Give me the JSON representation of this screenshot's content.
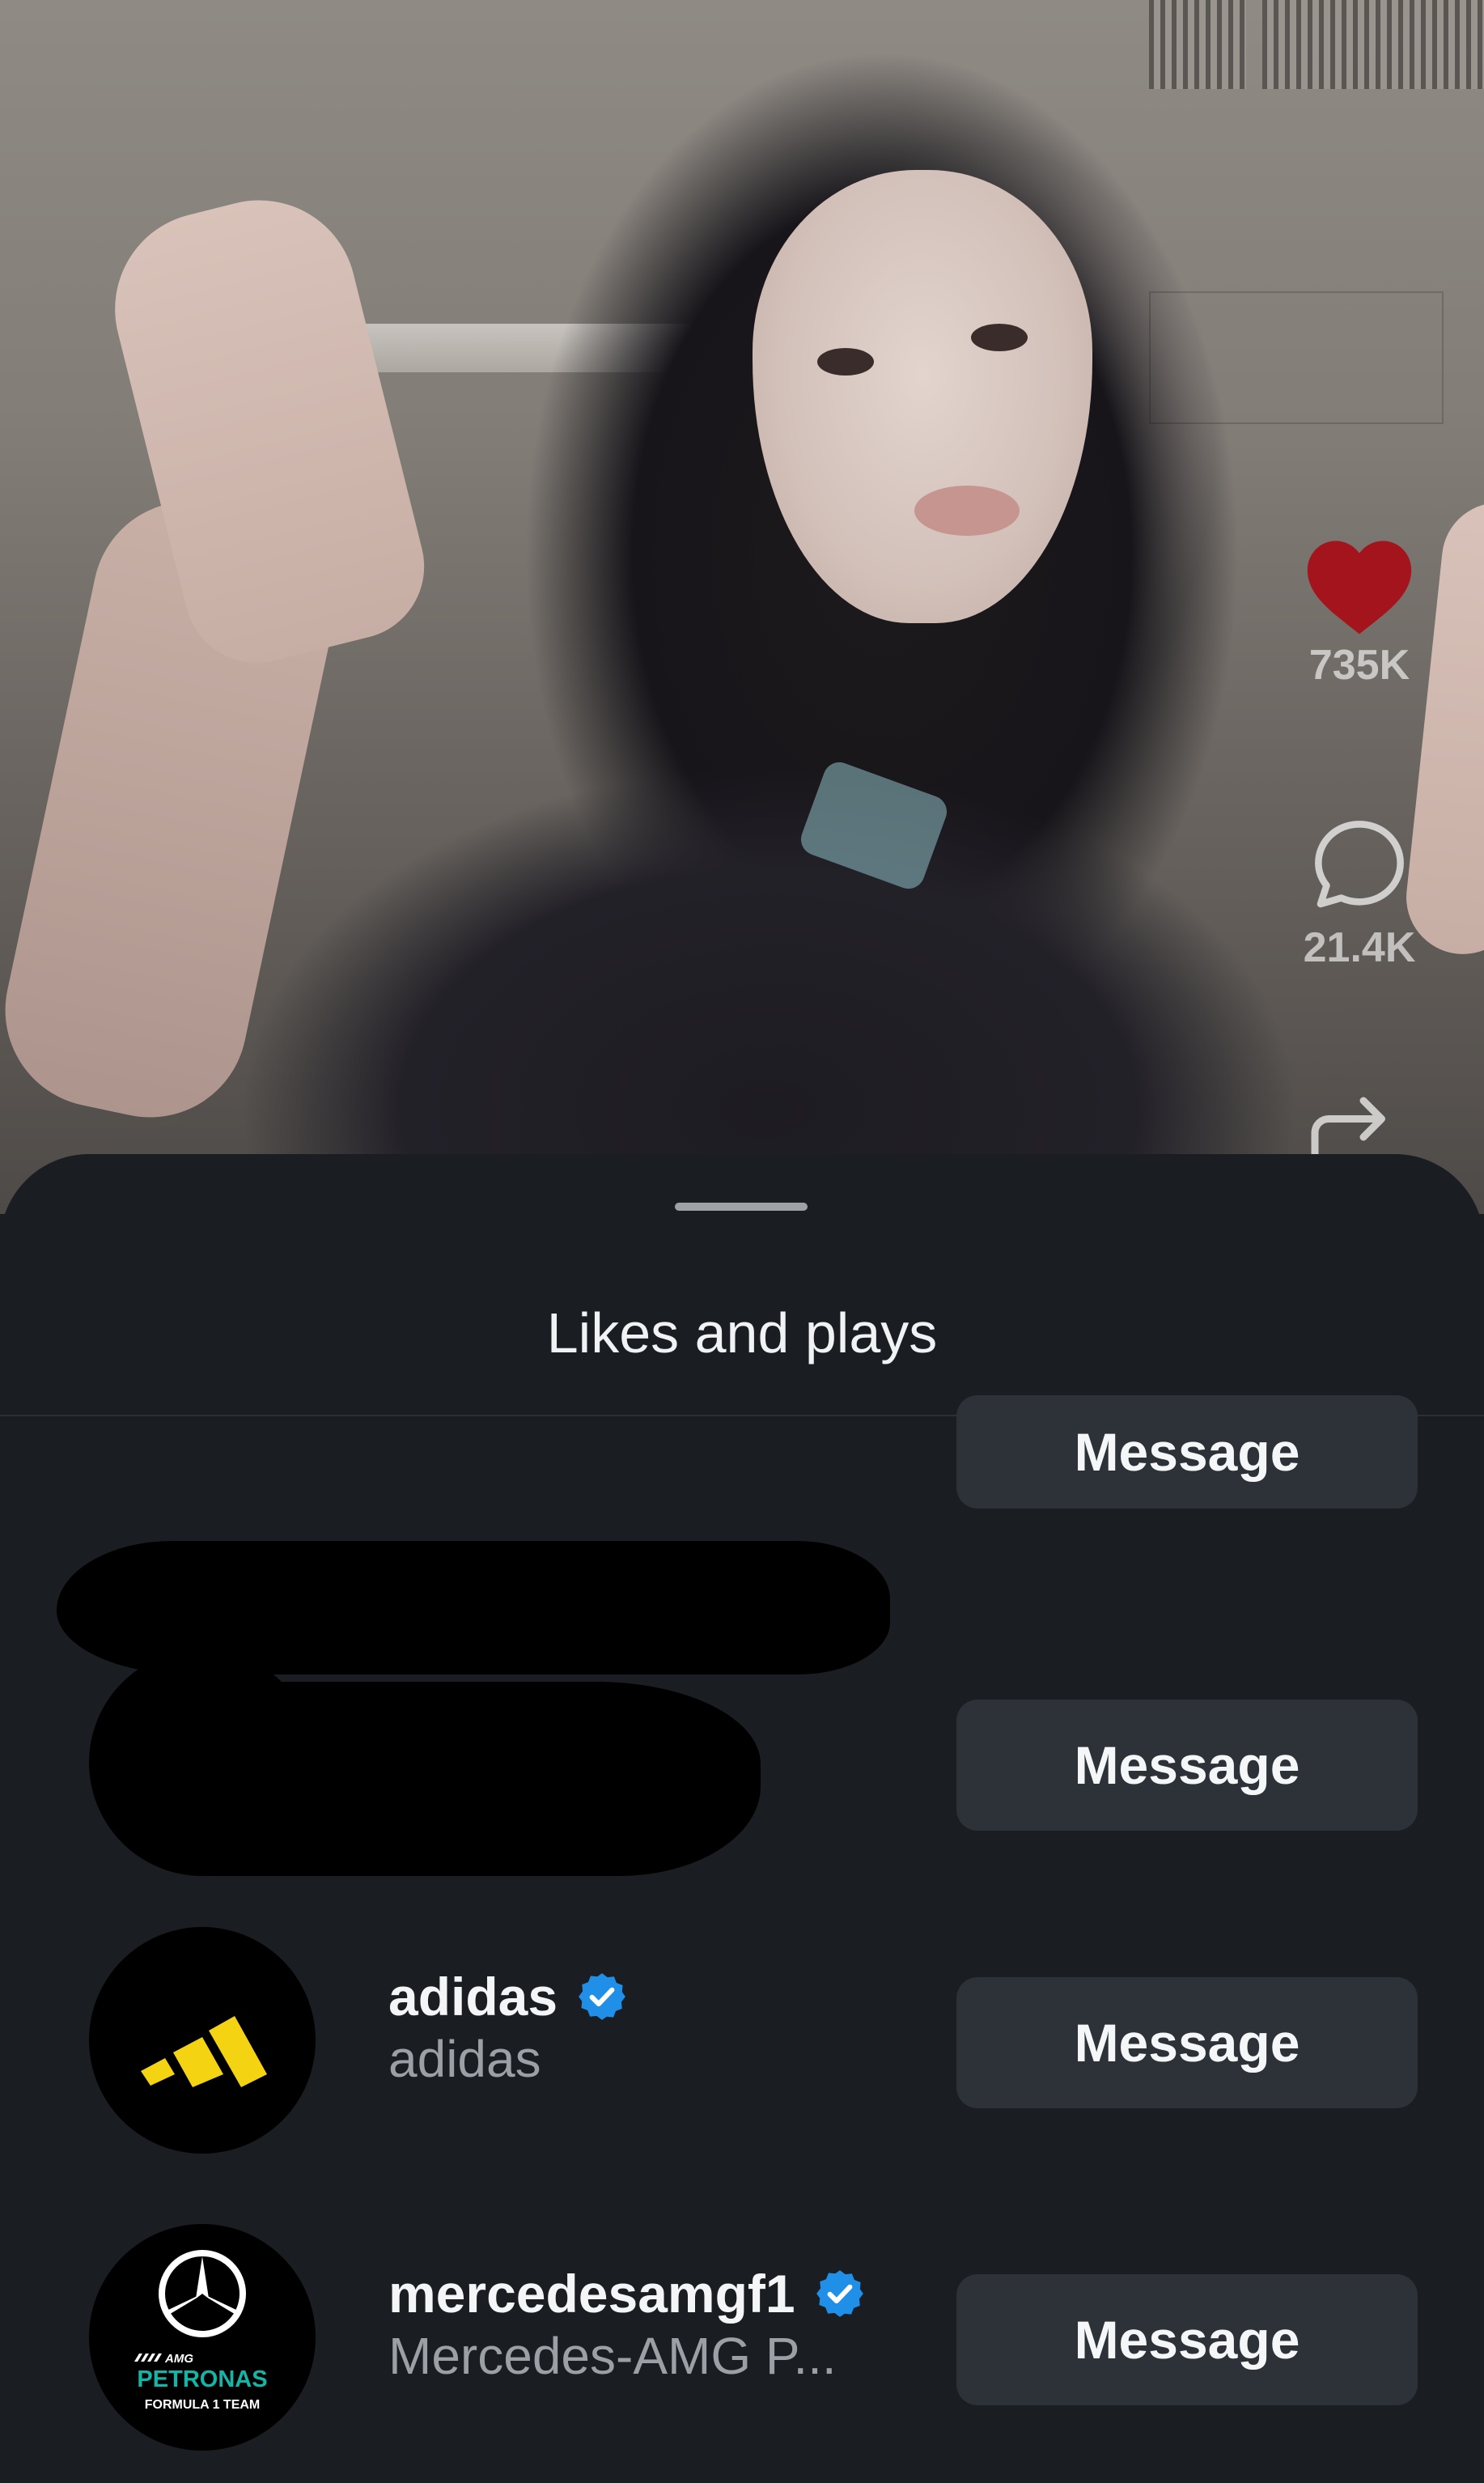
{
  "video": {
    "likes": "735K",
    "comments": "21.4K",
    "like_color": "#a3141c"
  },
  "sheet": {
    "title": "Likes and plays"
  },
  "accounts": [
    {
      "username": "",
      "fullname": "",
      "button": "Message",
      "redacted": true
    },
    {
      "username": "",
      "fullname": "",
      "button": "Message",
      "redacted": true
    },
    {
      "username": "adidas",
      "fullname": "adidas",
      "verified": true,
      "button": "Message",
      "avatar_icon": "adidas-logo-icon"
    },
    {
      "username": "mercedesamgf1",
      "fullname": "Mercedes-AMG P...",
      "verified": true,
      "button": "Message",
      "avatar_icon": "mercedes-amg-petronas-logo-icon",
      "avatar_text": {
        "brand": "AMG",
        "team": "PETRONAS",
        "sub": "FORMULA 1 TEAM"
      }
    }
  ],
  "colors": {
    "sheet_bg": "#1a1d21",
    "button_bg": "#2d3138",
    "verified_blue": "#1f8fe8",
    "adidas_yellow": "#f4d312",
    "petronas_teal": "#13b5a6"
  }
}
